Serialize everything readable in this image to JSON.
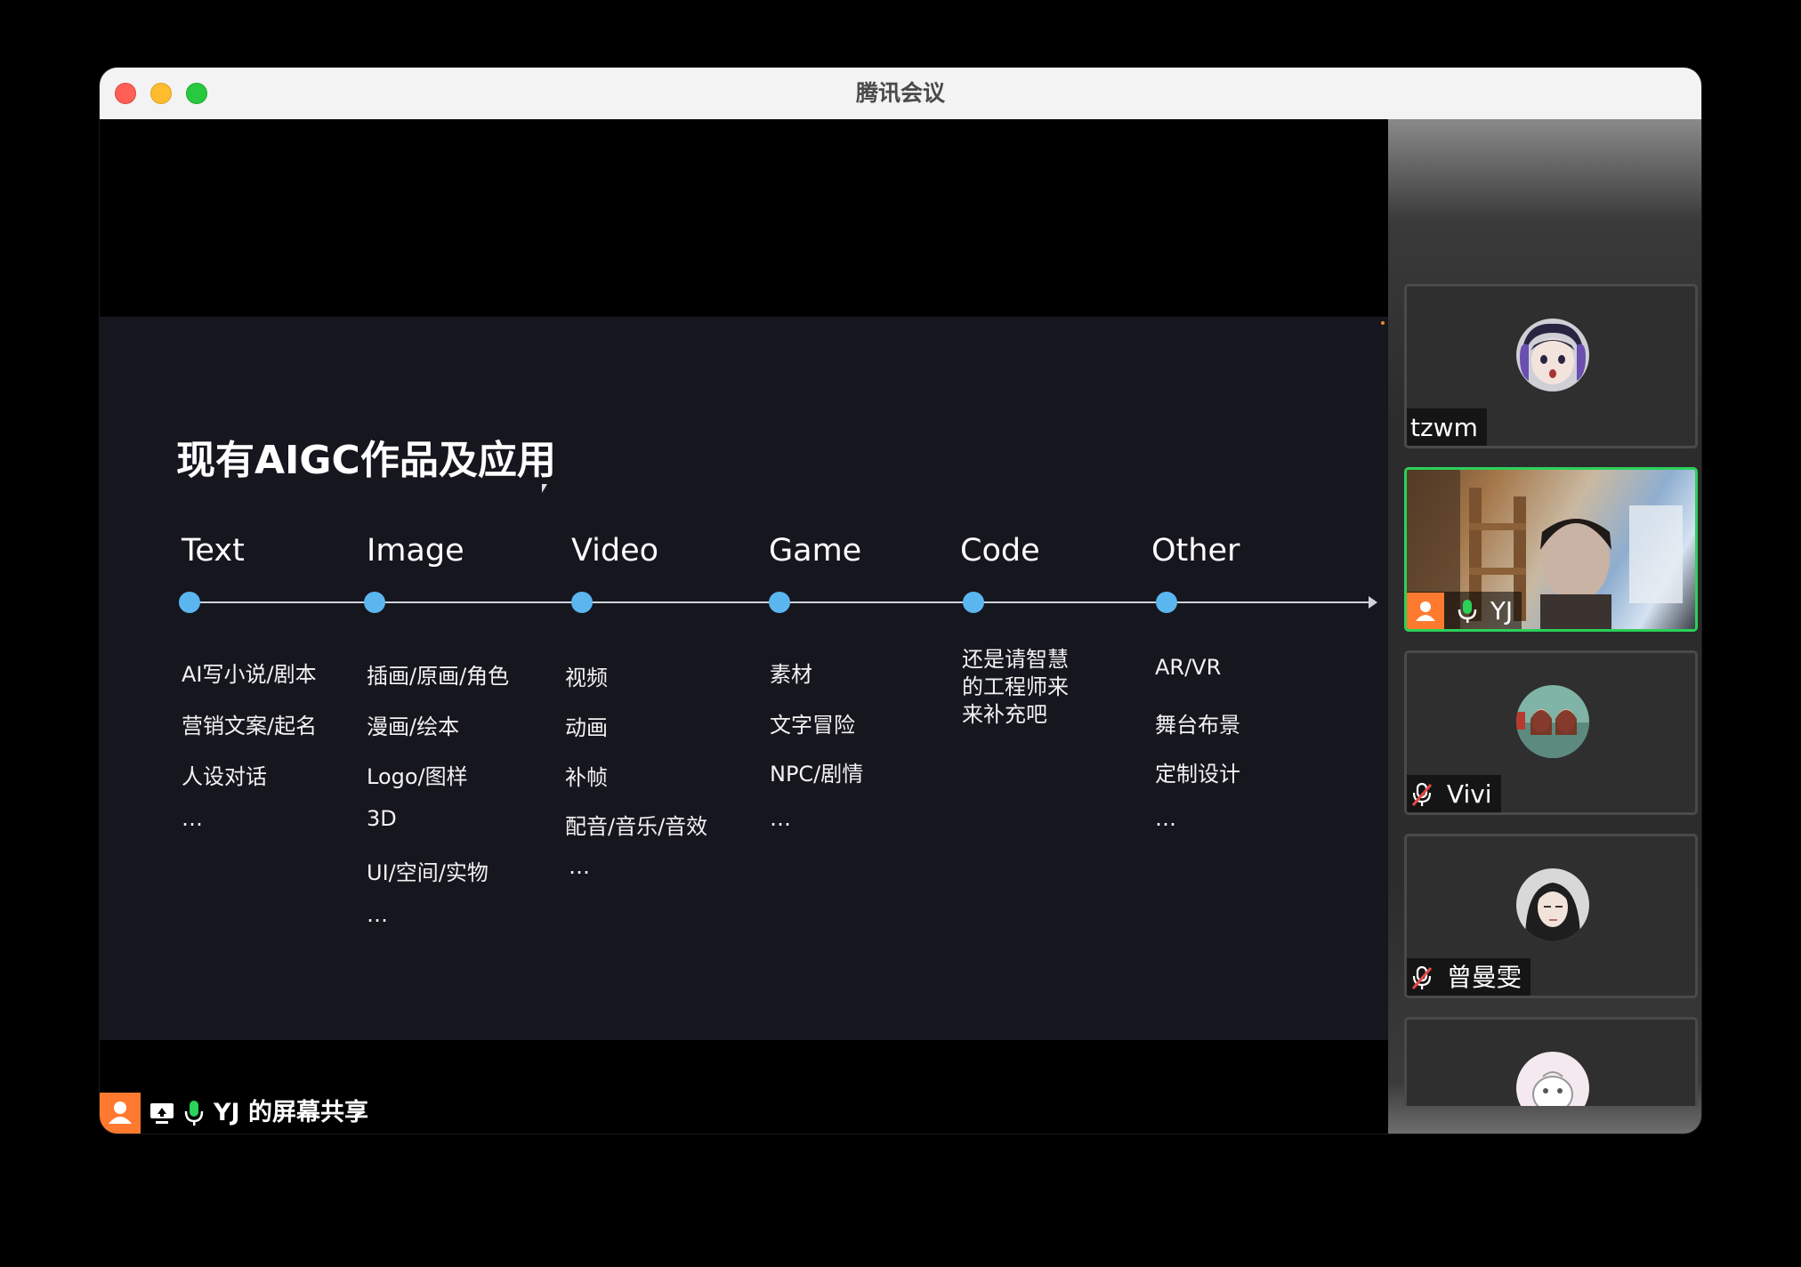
{
  "window": {
    "title": "腾讯会议"
  },
  "slide": {
    "title": "现有AIGC作品及应用",
    "categories": [
      {
        "label": "Text",
        "items": [
          "AI写小说/剧本",
          "营销文案/起名",
          "人设对话",
          "…"
        ]
      },
      {
        "label": "Image",
        "items": [
          "插画/原画/角色",
          "漫画/绘本",
          "Logo/图样",
          "3D",
          "UI/空间/实物",
          "…"
        ]
      },
      {
        "label": "Video",
        "items": [
          "视频",
          "动画",
          "补帧",
          "配音/音乐/音效",
          "…"
        ]
      },
      {
        "label": "Game",
        "items": [
          "素材",
          "文字冒险",
          "NPC/剧情",
          "…"
        ]
      },
      {
        "label": "Code",
        "items": [
          "还是请智慧的工程师来来补充吧"
        ]
      },
      {
        "label": "Other",
        "items": [
          "AR/VR",
          "舞台布景",
          "定制设计",
          "…"
        ]
      }
    ],
    "accent_color": "#5bb6f0",
    "background_color": "#16161f"
  },
  "presenter": {
    "label": "YJ 的屏幕共享",
    "mic": "on"
  },
  "participants": [
    {
      "name": "tzwm",
      "mic": "none",
      "avatar_icon": "anime-avatar-icon"
    },
    {
      "name": "YJ",
      "mic": "on",
      "active_speaker": true,
      "video": "on"
    },
    {
      "name": "Vivi",
      "mic": "muted",
      "avatar_icon": "photo-avatar-icon"
    },
    {
      "name": "曾曼雯",
      "mic": "muted",
      "avatar_icon": "photo-avatar-icon"
    },
    {
      "name": "",
      "mic": "none",
      "avatar_icon": "cartoon-avatar-icon"
    }
  ],
  "colors": {
    "active_border": "#2bd159",
    "presenter_badge": "#ff7a2f",
    "mic_on": "#2bd159"
  }
}
